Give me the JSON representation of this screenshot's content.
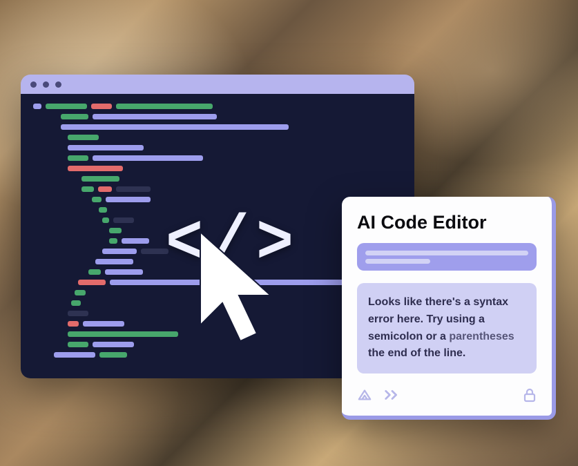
{
  "colors": {
    "titlebar": "#b6b4ee",
    "editor_bg": "#151935",
    "panel_bg": "#fdfdfe",
    "accent": "#9f9eec",
    "message_bg": "#d0d0f4",
    "code_green": "#47a76c",
    "code_purple": "#9d9ded",
    "code_red": "#e26b6b"
  },
  "ai_panel": {
    "title": "AI Code Editor",
    "message": "Looks like there's a syntax error here.  Try using a semicolon or a ",
    "highlight": "parentheses",
    "message_tail": " the end of the line."
  },
  "icons": {
    "cursor": "cursor-icon",
    "code_tag": "code-tag-icon",
    "send": "send-icon",
    "forward": "forward-icon",
    "lock": "lock-icon"
  }
}
